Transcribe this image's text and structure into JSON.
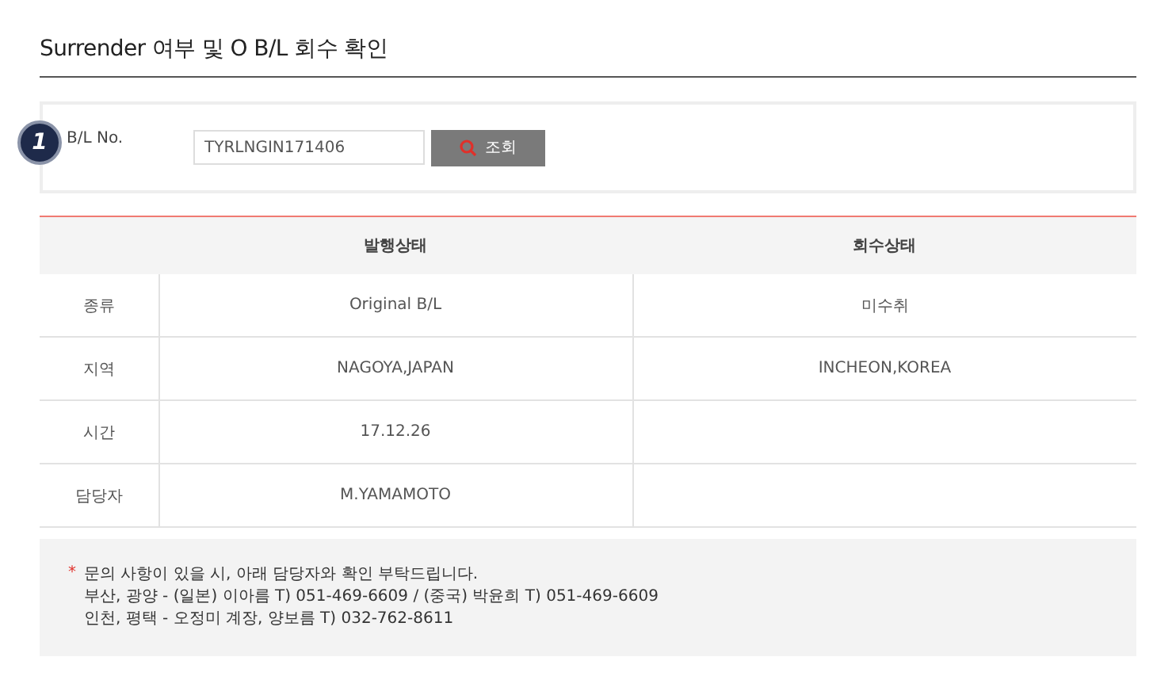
{
  "title": "Surrender 여부 및 O B/L 회수 확인",
  "search": {
    "step": "1",
    "label": "B/L No.",
    "value": "TYRLNGIN171406",
    "button": "조회"
  },
  "table": {
    "columns": [
      "발행상태",
      "회수상태"
    ],
    "rows": [
      {
        "label": "종류",
        "cells": [
          "Original B/L",
          "미수취"
        ]
      },
      {
        "label": "지역",
        "cells": [
          "NAGOYA,JAPAN",
          "INCHEON,KOREA"
        ]
      },
      {
        "label": "시간",
        "cells": [
          "17.12.26",
          ""
        ]
      },
      {
        "label": "담당자",
        "cells": [
          "M.YAMAMOTO",
          ""
        ]
      }
    ]
  },
  "notice": {
    "mark": "*",
    "lines": [
      "문의 사항이 있을 시, 아래 담당자와 확인 부탁드립니다.",
      "부산, 광양 - (일본) 이아름 T) 051-469-6609 / (중국) 박윤희 T) 051-469-6609",
      "인천, 평택 - 오정미 계장, 양보름 T) 032-762-8611"
    ]
  }
}
